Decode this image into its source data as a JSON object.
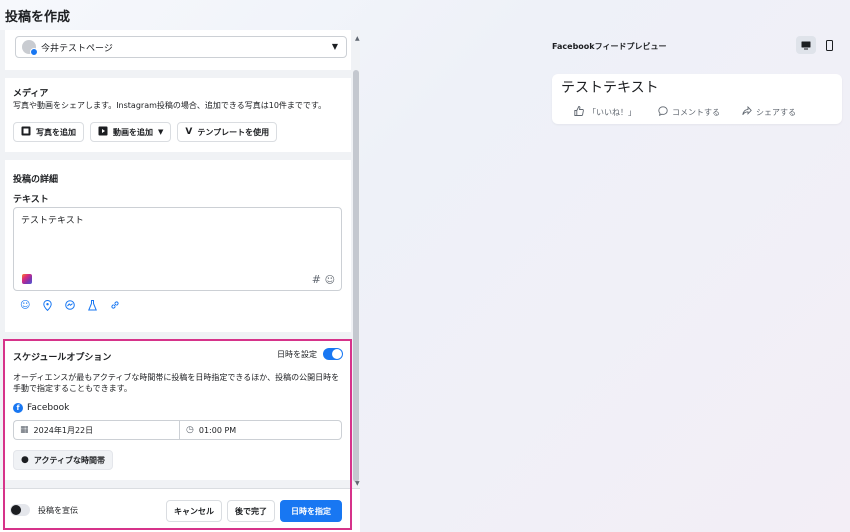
{
  "header": {
    "title": "投稿を作成"
  },
  "page_select": {
    "value": "今井テストページ"
  },
  "media": {
    "heading": "メディア",
    "description": "写真や動画をシェアします。Instagram投稿の場合、追加できる写真は10件までです。",
    "add_photo": "写真を追加",
    "add_video": "動画を追加",
    "use_template": "テンプレートを使用"
  },
  "details": {
    "heading": "投稿の詳細",
    "text_label": "テキスト",
    "text_value": "テストテキスト",
    "hash_symbol": "#"
  },
  "schedule": {
    "heading": "スケジュールオプション",
    "toggle_label": "日時を設定",
    "description": "オーディエンスが最もアクティブな時間帯に投稿を日時指定できるほか、投稿の公開日時を手動で指定することもできます。",
    "platform": "Facebook",
    "date": "2024年1月22日",
    "time": "01:00 PM",
    "active_times_button": "アクティブな時間帯"
  },
  "footer": {
    "boost_label": "投稿を宣伝",
    "cancel": "キャンセル",
    "finish_later": "後で完了",
    "schedule": "日時を指定"
  },
  "preview": {
    "label": "Facebookフィードプレビュー",
    "text": "テストテキスト",
    "like": "「いいね！」",
    "comment": "コメントする",
    "share": "シェアする"
  },
  "colors": {
    "accent": "#1877f2",
    "highlight": "#d6338a"
  }
}
